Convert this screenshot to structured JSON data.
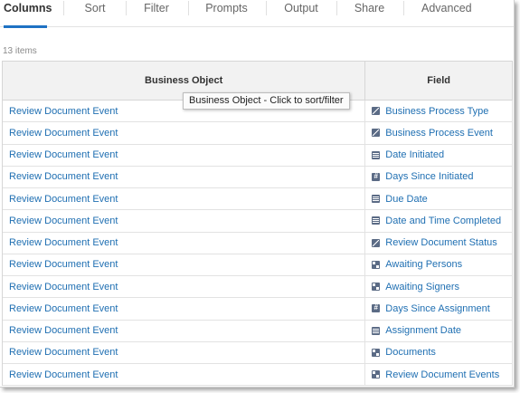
{
  "tabs": [
    {
      "label": "Columns",
      "active": true
    },
    {
      "label": "Sort"
    },
    {
      "label": "Filter"
    },
    {
      "label": "Prompts"
    },
    {
      "label": "Output"
    },
    {
      "label": "Share"
    },
    {
      "label": "Advanced"
    }
  ],
  "item_count": "13 items",
  "table": {
    "headers": [
      "Business Object",
      "Field"
    ],
    "rows": [
      {
        "business_object": "Review Document Event",
        "field": "Business Process Type",
        "field_icon": "single-instance-icon"
      },
      {
        "business_object": "Review Document Event",
        "field": "Business Process Event",
        "field_icon": "single-instance-icon"
      },
      {
        "business_object": "Review Document Event",
        "field": "Date Initiated",
        "field_icon": "date-icon"
      },
      {
        "business_object": "Review Document Event",
        "field": "Days Since Initiated",
        "field_icon": "number-icon"
      },
      {
        "business_object": "Review Document Event",
        "field": "Due Date",
        "field_icon": "date-icon"
      },
      {
        "business_object": "Review Document Event",
        "field": "Date and Time Completed",
        "field_icon": "date-icon"
      },
      {
        "business_object": "Review Document Event",
        "field": "Review Document Status",
        "field_icon": "single-instance-icon"
      },
      {
        "business_object": "Review Document Event",
        "field": "Awaiting Persons",
        "field_icon": "multi-instance-icon"
      },
      {
        "business_object": "Review Document Event",
        "field": "Awaiting Signers",
        "field_icon": "multi-instance-icon"
      },
      {
        "business_object": "Review Document Event",
        "field": "Days Since Assignment",
        "field_icon": "number-icon"
      },
      {
        "business_object": "Review Document Event",
        "field": "Assignment Date",
        "field_icon": "date-icon"
      },
      {
        "business_object": "Review Document Event",
        "field": "Documents",
        "field_icon": "multi-instance-icon"
      },
      {
        "business_object": "Review Document Event",
        "field": "Review Document Events",
        "field_icon": "multi-instance-icon"
      }
    ]
  },
  "tooltip": "Business Object - Click to sort/filter",
  "colors": {
    "accent": "#1f72c4",
    "link": "#1f6fb2",
    "header_bg": "#f2f2f2"
  }
}
